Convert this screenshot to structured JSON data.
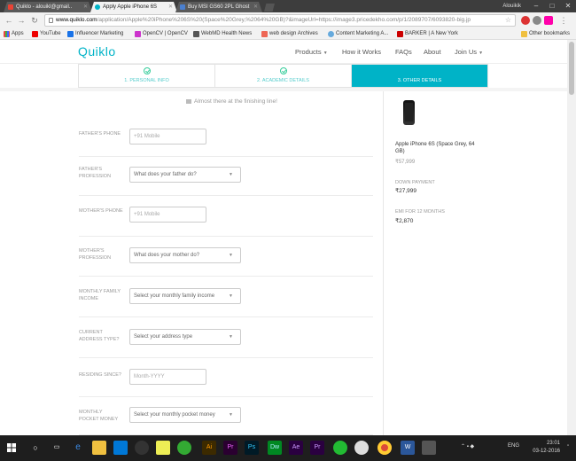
{
  "browser": {
    "tabs": [
      {
        "label": "Quiklo - alouikl@gmail..",
        "color": "#ea4335"
      },
      {
        "label": "Apply Apple iPhone 6S",
        "color": "#00b3c7"
      },
      {
        "label": "Buy MSI GS60 2PL Ghost",
        "color": "#2b579a"
      }
    ],
    "user": "Alouikik",
    "url_host": "www.quiklo.com",
    "url_path": "/application/Apple%20iPhone%206S%20(Space%20Grey,%2064%20GB)?&imageUrl=https://image3.pricedekho.com/p/1/2089707/6093820-big.jp",
    "bookmarks": [
      "Apps",
      "YouTube",
      "Influencer Marketing",
      "OpenCV | OpenCV",
      "WebMD Health News",
      "web design Archives",
      "Content Marketing A...",
      "BARKER | A New York",
      "Other bookmarks"
    ]
  },
  "site": {
    "logo": "Quiklo",
    "menu": {
      "products": "Products",
      "how": "How it Works",
      "faqs": "FAQs",
      "about": "About",
      "join": "Join Us"
    }
  },
  "steps": [
    {
      "label": "1. PERSONAL INFO"
    },
    {
      "label": "2. ACADEMIC DETAILS"
    },
    {
      "label": "3. OTHER DETAILS"
    }
  ],
  "form": {
    "banner": "Almost there at the finishing line!",
    "fathers_phone": {
      "label": "FATHER'S PHONE",
      "value": "+91     Mobile"
    },
    "fathers_profession": {
      "label": "FATHER'S PROFESSION",
      "value": "What does your father do?"
    },
    "mothers_phone": {
      "label": "MOTHER'S PHONE",
      "value": "+91     Mobile"
    },
    "mothers_profession": {
      "label": "MOTHER'S PROFESSION",
      "value": "What does your mother do?"
    },
    "monthly_income": {
      "label": "MONTHLY FAMILY INCOME",
      "value": "Select your monthly family income"
    },
    "address_type": {
      "label": "CURRENT ADDRESS TYPE?",
      "value": "Select your address type"
    },
    "residing_since": {
      "label": "RESIDING SINCE?",
      "placeholder": "Month-YYYY"
    },
    "pocket_money": {
      "label": "MONTHLY POCKET MONEY",
      "value": "Select your monthly pocket money"
    }
  },
  "sidebar": {
    "product_name": "Apple iPhone 6S (Space Grey, 64 GB)",
    "price": "₹57,999",
    "down_payment_label": "DOWN PAYMENT",
    "down_payment": "₹27,999",
    "emi_label": "EMI FOR 12 MONTHS",
    "emi": "₹2,870"
  },
  "taskbar": {
    "lang": "ENG",
    "time": "23:01",
    "date": "03-12-2016"
  }
}
